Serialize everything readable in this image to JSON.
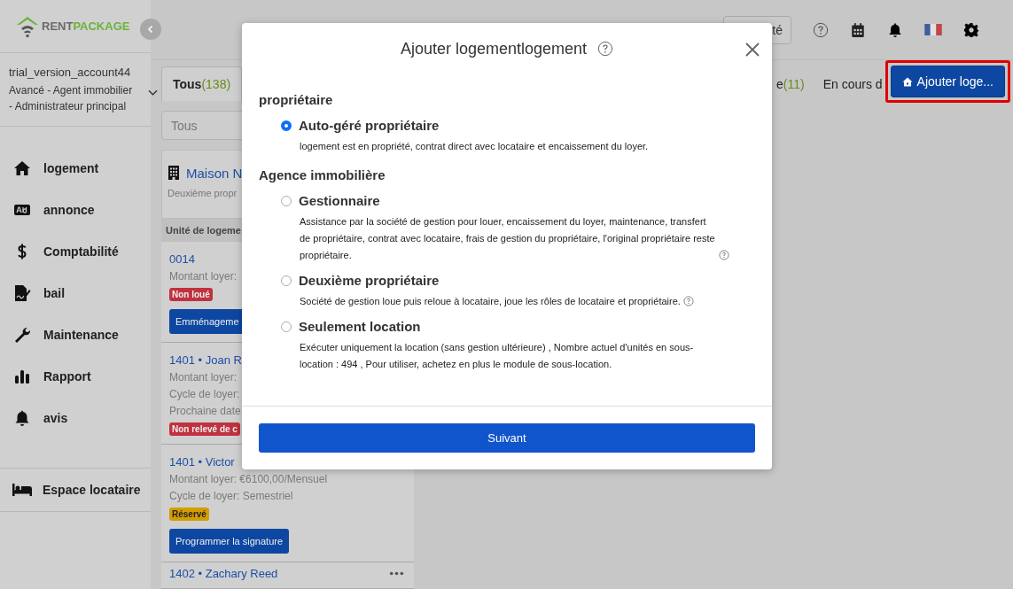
{
  "sidebar": {
    "logo": {
      "part_1": "RENT",
      "part_2": "PACKAGE"
    },
    "account": {
      "name": "trial_version_account44",
      "role": "Avancé - Agent immobilier - Administrateur principal"
    },
    "nav": [
      {
        "label": "logement"
      },
      {
        "label": "annonce"
      },
      {
        "label": "Comptabilité"
      },
      {
        "label": "bail"
      },
      {
        "label": "Maintenance"
      },
      {
        "label": "Rapport"
      },
      {
        "label": "avis"
      }
    ],
    "footer_item": {
      "label": "Espace locataire"
    }
  },
  "topbar": {
    "button": "té"
  },
  "tabs": [
    {
      "label": "Tous",
      "count": "(138)",
      "selected": true
    },
    {
      "label": "e",
      "count": "(11)",
      "selected": false
    },
    {
      "label": "En cours d",
      "selected": false
    }
  ],
  "add_button": {
    "label": "Ajouter loge...",
    "highlighted": true
  },
  "filter": {
    "placeholder": "Tous"
  },
  "property": {
    "name": "Maison N",
    "subtitle": "Deuxième propr"
  },
  "units_header": "Unité de logeme",
  "units": [
    {
      "title": "0014",
      "lines": [
        "Montant loyer:"
      ],
      "badge": {
        "text": "Non loué",
        "kind": "danger"
      },
      "button": "Emménageme"
    },
    {
      "title": "1401 • Joan R",
      "lines": [
        "Montant loyer:",
        "Cycle de loyer:",
        "Prochaine date"
      ],
      "badge": {
        "text": "Non relevé de c",
        "kind": "danger"
      }
    },
    {
      "title": "1401 • Victor",
      "lines": [
        "Montant loyer: €6100,00/Mensuel",
        "Cycle de loyer: Semestriel"
      ],
      "badge": {
        "text": "Réservé",
        "kind": "warning"
      },
      "button": "Programmer la signature"
    },
    {
      "title": "1402 • Zachary Reed",
      "menu": true
    }
  ],
  "modal": {
    "title": "Ajouter logementlogement",
    "groups": [
      {
        "heading": "propriétaire",
        "options": [
          {
            "label": "Auto-géré propriétaire",
            "description": "logement est en propriété, contrat direct avec locataire et encaissement du loyer.",
            "selected": true
          }
        ]
      },
      {
        "heading": "Agence immobilière",
        "options": [
          {
            "label": "Gestionnaire",
            "description": "Assistance par la société de gestion pour louer, encaissement du loyer, maintenance, transfert de propriétaire, contrat avec locataire, frais de gestion du propriétaire, l'original propriétaire reste propriétaire.",
            "help": true,
            "selected": false
          },
          {
            "label": "Deuxième propriétaire",
            "description": "Société de gestion loue puis reloue à locataire, joue les rôles de locataire et propriétaire.",
            "help": true,
            "selected": false
          },
          {
            "label": "Seulement location",
            "description": "Exécuter uniquement la location (sans gestion ultérieure) , Nombre actuel d'unités en sous-location : 494 , Pour utiliser, achetez en plus le module de sous-location.",
            "selected": false
          }
        ]
      }
    ],
    "button": "Suivant"
  }
}
